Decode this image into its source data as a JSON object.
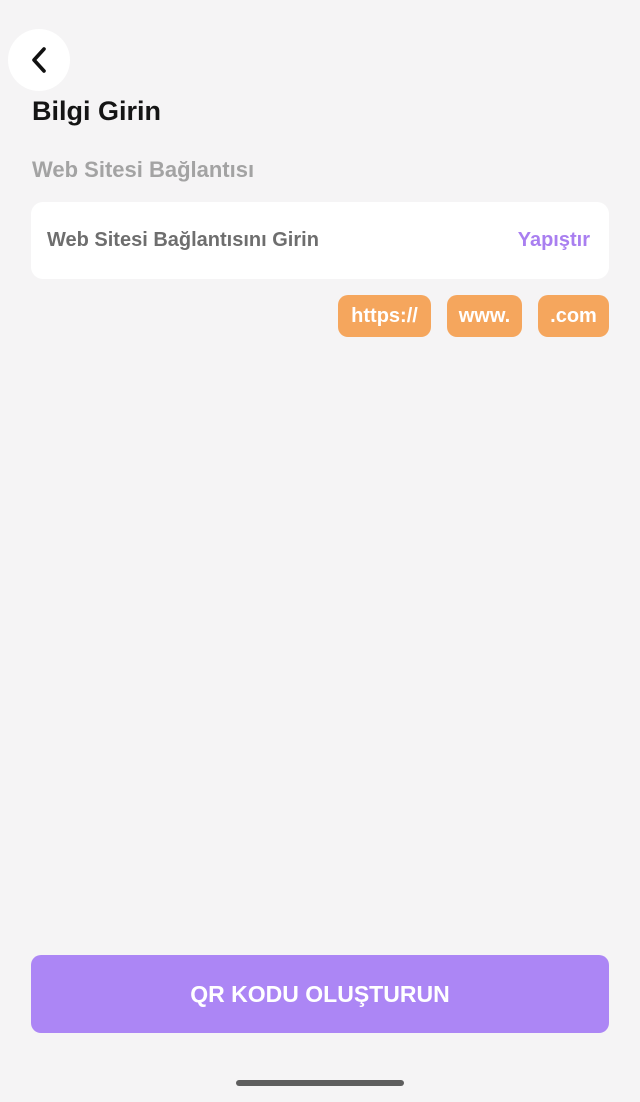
{
  "header": {
    "back_icon": "chevron-left-icon",
    "title": "Bilgi Girin"
  },
  "form": {
    "section_label": "Web Sitesi Bağlantısı",
    "url_field": {
      "placeholder": "Web Sitesi Bağlantısını Girin",
      "value": "",
      "paste_label": "Yapıştır"
    },
    "quick_insert": [
      {
        "label": "https://"
      },
      {
        "label": "www."
      },
      {
        "label": ".com"
      }
    ]
  },
  "footer": {
    "generate_label": "QR KODU OLUŞTURUN"
  },
  "colors": {
    "background": "#f5f4f5",
    "accent": "#ac86f5",
    "paste_text": "#a97ff0",
    "chip": "#f5a65d"
  }
}
